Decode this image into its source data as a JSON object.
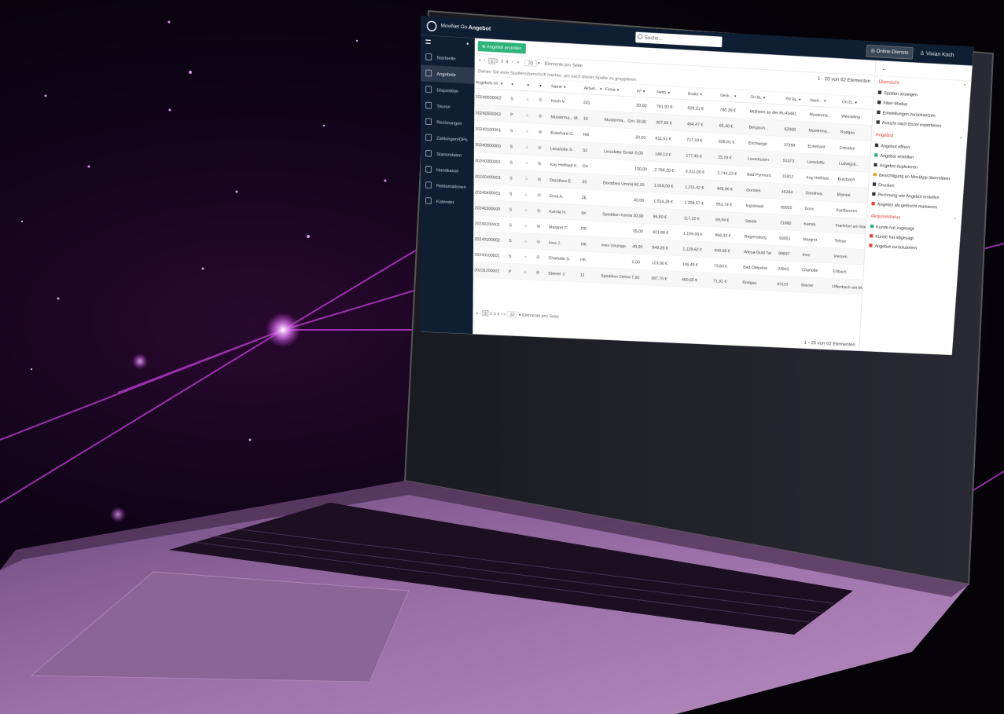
{
  "app": {
    "name": "MoviNet Go",
    "page_title": "Angebot"
  },
  "topbar": {
    "search_placeholder": "Suche...",
    "online_services": "Online-Dienste",
    "user_name": "Vivian Koch"
  },
  "sidebar": {
    "items": [
      {
        "label": "Startseite",
        "icon": "home-icon"
      },
      {
        "label": "Angebote",
        "icon": "document-icon",
        "active": true
      },
      {
        "label": "Disposition",
        "icon": "clipboard-icon"
      },
      {
        "label": "Touren",
        "icon": "route-icon"
      },
      {
        "label": "Rechnungen",
        "icon": "invoice-icon"
      },
      {
        "label": "Zahlungen/OPs",
        "icon": "wallet-icon"
      },
      {
        "label": "Stammdaten",
        "icon": "database-icon"
      },
      {
        "label": "Handkasse",
        "icon": "cash-icon"
      },
      {
        "label": "Reklamationen",
        "icon": "alert-icon"
      },
      {
        "label": "Kalender",
        "icon": "calendar-icon"
      }
    ]
  },
  "toolbar": {
    "create_label": "Angebot erstellen"
  },
  "pager": {
    "pages": [
      "1",
      "2",
      "3",
      "4"
    ],
    "per_page": "20",
    "per_page_label": "Elemente pro Seite",
    "count": "1 - 20 von 62 Elementen",
    "bottom_pages": [
      "1",
      "2",
      "3",
      "4"
    ],
    "bottom_count": "1 - 20 von 62 Elementen"
  },
  "group_hint": "Ziehen Sie eine Spaltenüberschrift hierher, um nach dieser Spalte zu gruppieren",
  "table": {
    "columns": [
      "Angebots-Nr.",
      "",
      "",
      "",
      "Name",
      "Aktuel...",
      "Firma",
      "m³",
      "Netto",
      "Brutto",
      "Deck...",
      "Ort BL",
      "Plz BL",
      "Nach...",
      "Ort EL"
    ],
    "rows": [
      [
        "20240600002",
        "S",
        "",
        "",
        "Koch V.",
        "DG",
        "",
        "30,00",
        "781,92 €",
        "929,51 €",
        "780,28 €",
        "Mülheim an der Ruhr",
        "45481",
        "Musterma...",
        "Wesseling"
      ],
      [
        "20240500001",
        "P",
        "",
        "",
        "Musterma... M.",
        "1K",
        "Musterma... GmbH",
        "18,00",
        "407,60 €",
        "484,47 €",
        "65,40 €",
        "Bergisch...",
        "62000",
        "Musterma...",
        "Rodgau"
      ],
      [
        "20240100001",
        "S",
        "",
        "",
        "Eckehard G.",
        "Hill",
        "",
        "20,00",
        "611,61 €",
        "727,19 €",
        "609,61 €",
        "Eschwege",
        "37269",
        "Eckehard",
        "Dresden"
      ],
      [
        "20240600003",
        "S",
        "",
        "",
        "Lieselotte S.",
        "3Z",
        "Lieselotte GmbH",
        "0,00",
        "149,13 €",
        "177,45 €",
        "25,19 €",
        "Leverkusen",
        "51373",
        "Lieselotte",
        "Ludwigsb..."
      ],
      [
        "20240300001",
        "S",
        "",
        "",
        "Kay Helfried K.",
        "OV",
        "",
        "100,00",
        "2.768,20 €",
        "3.311,00 €",
        "2.744,23 €",
        "Bad Pyrmont",
        "31812",
        "Kay Helfried",
        "Butzbach"
      ],
      [
        "20240400003",
        "S",
        "",
        "",
        "Dorothea E.",
        "3S",
        "Dorothea Umzüge",
        "60,00",
        "1.018,00 €",
        "1.211,42 €",
        "409,96 €",
        "Dorsten",
        "46284",
        "Dorothea",
        "Maintal"
      ],
      [
        "20240400001",
        "S",
        "",
        "",
        "Dora A.",
        "2E",
        "",
        "40,00",
        "1.014,28 €",
        "1.208,97 €",
        "951,74 €",
        "Ingolstadt",
        "85055",
        "Dora",
        "Kaufbeuren"
      ],
      [
        "20240300000",
        "S",
        "",
        "",
        "Karola H.",
        "5K",
        "Spedition Karola",
        "30,00",
        "96,50 €",
        "117,22 €",
        "69,94 €",
        "Steele",
        "21680",
        "Karola",
        "Frankfurt am Main"
      ],
      [
        "20240200001",
        "S",
        "",
        "",
        "Margret F.",
        "PR",
        "",
        "35,00",
        "931,98 €",
        "1.109,06 €",
        "868,43 €",
        "Regensburg",
        "93051",
        "Margret",
        "Teltow"
      ],
      [
        "20240100002",
        "S",
        "",
        "",
        "Ines J.",
        "OK",
        "Ines Umzüge",
        "40,00",
        "949,26 €",
        "1.129,62 €",
        "940,86 €",
        "Wiesa-Gutti Tal",
        "99837",
        "Ines",
        "Viersen"
      ],
      [
        "20240100001",
        "S",
        "",
        "",
        "Charlotte S.",
        "HK",
        "",
        "0,00",
        "123,00 €",
        "146,49 €",
        "73,83 €",
        "Bad Oldesloe",
        "23843",
        "Charlotte",
        "Erlbach"
      ],
      [
        "20231200001",
        "P",
        "",
        "",
        "Steiner J.",
        "1J",
        "Spedition Steiner",
        "7,00",
        "387,70 €",
        "460,65 €",
        "71,91 €",
        "Rodgau",
        "63110",
        "Steiner",
        "Offenbach am Main"
      ]
    ]
  },
  "panel": {
    "sections": [
      {
        "title": "Übersicht",
        "items": [
          {
            "label": "Spalten anzeigen",
            "icon": "gear-icon",
            "color": "#333333"
          },
          {
            "label": "Filter-Modus",
            "icon": "filter-icon",
            "color": "#333333"
          },
          {
            "label": "Einstellungen zurücksetzen",
            "icon": "reset-icon",
            "color": "#333333"
          },
          {
            "label": "Ansicht nach Excel exportieren",
            "icon": "excel-icon",
            "color": "#333333"
          }
        ]
      },
      {
        "title": "Angebot",
        "items": [
          {
            "label": "Angebot öffnen",
            "icon": "pencil-icon",
            "color": "#333333"
          },
          {
            "label": "Angebot erstellen",
            "icon": "plus-icon",
            "color": "#2eb37a"
          },
          {
            "label": "Angebot duplizieren",
            "icon": "copy-icon",
            "color": "#333333"
          },
          {
            "label": "Besichtigung an MoviApp übermitteln",
            "icon": "warning-icon",
            "color": "#f0a030"
          },
          {
            "label": "Drucken",
            "icon": "print-icon",
            "color": "#333333"
          },
          {
            "label": "Rechnung wie Angebot erstellen",
            "icon": "invoice-icon",
            "color": "#333333"
          },
          {
            "label": "Angebot als gelöscht markieren",
            "icon": "trash-icon",
            "color": "#e0433c"
          }
        ]
      },
      {
        "title": "Akquisestatus",
        "items": [
          {
            "label": "Kunde hat zugesagt",
            "icon": "thumbs-up-icon",
            "color": "#2eb37a"
          },
          {
            "label": "Kunde hat abgesagt",
            "icon": "thumbs-down-icon",
            "color": "#e0433c"
          },
          {
            "label": "Angebot zurückziehen",
            "icon": "cancel-icon",
            "color": "#e0433c"
          }
        ]
      }
    ]
  },
  "colors": {
    "accent_green": "#2eb37a",
    "accent_red": "#e0433c",
    "navy": "#0f1f33",
    "glow": "#c23fd6"
  }
}
